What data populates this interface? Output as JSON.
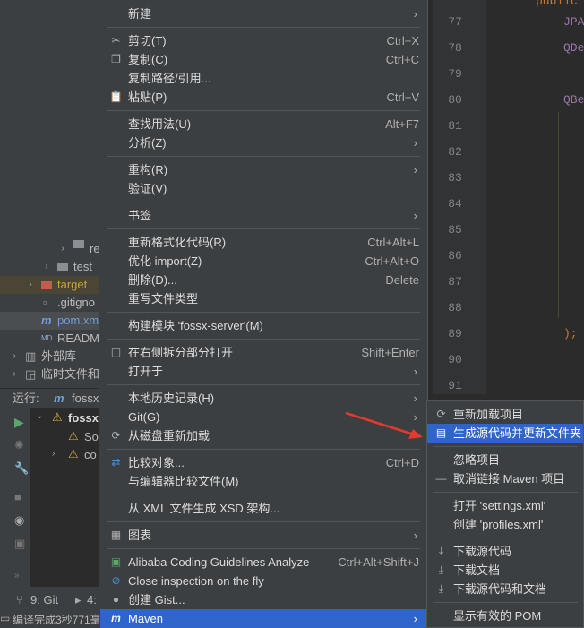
{
  "project_tree": [
    {
      "label": "re",
      "type": "folder",
      "indent": 68
    },
    {
      "label": "test",
      "type": "folder",
      "indent": 50
    },
    {
      "label": "target",
      "type": "folder",
      "indent": 32
    },
    {
      "label": ".gitigno",
      "type": "file"
    },
    {
      "label": "pom.xm",
      "type": "maven"
    },
    {
      "label": "READM",
      "type": "md"
    },
    {
      "label": "外部库",
      "type": "lib"
    },
    {
      "label": "临时文件和控",
      "type": "scratch"
    }
  ],
  "run_bar": {
    "label": "运行:",
    "tab": "fossx"
  },
  "run_tree": {
    "root": "fossx",
    "child1": "So",
    "child2": "co"
  },
  "status_bar": {
    "git_tab": "9: Git",
    "tab2": "4:",
    "message": "编译完成3秒771毫"
  },
  "editor": {
    "line_numbers": [
      "77",
      "78",
      "79",
      "80",
      "81",
      "82",
      "83",
      "84",
      "85",
      "86",
      "87",
      "88",
      "89",
      "90",
      "91"
    ],
    "code": [
      {
        "line": "77",
        "text": "JPA"
      },
      {
        "line": "78",
        "text": "QDe"
      },
      {
        "line": "80",
        "text": "QBe"
      },
      {
        "line": "89",
        "text": ");"
      }
    ],
    "top_text": "public"
  },
  "context_menu": {
    "items": [
      {
        "label": "新建",
        "shortcut": "",
        "submenu": true,
        "icon": ""
      },
      {
        "sep": true
      },
      {
        "label": "剪切(T)",
        "shortcut": "Ctrl+X",
        "icon": "✂"
      },
      {
        "label": "复制(C)",
        "shortcut": "Ctrl+C",
        "icon": "❐"
      },
      {
        "label": "复制路径/引用...",
        "shortcut": "",
        "icon": ""
      },
      {
        "label": "粘贴(P)",
        "shortcut": "Ctrl+V",
        "icon": "📋"
      },
      {
        "sep": true
      },
      {
        "label": "查找用法(U)",
        "shortcut": "Alt+F7",
        "icon": ""
      },
      {
        "label": "分析(Z)",
        "shortcut": "",
        "submenu": true,
        "icon": ""
      },
      {
        "sep": true
      },
      {
        "label": "重构(R)",
        "shortcut": "",
        "submenu": true,
        "icon": ""
      },
      {
        "label": "验证(V)",
        "shortcut": "",
        "icon": ""
      },
      {
        "sep": true
      },
      {
        "label": "书签",
        "shortcut": "",
        "submenu": true,
        "icon": ""
      },
      {
        "sep": true
      },
      {
        "label": "重新格式化代码(R)",
        "shortcut": "Ctrl+Alt+L",
        "icon": ""
      },
      {
        "label": "优化 import(Z)",
        "shortcut": "Ctrl+Alt+O",
        "icon": ""
      },
      {
        "label": "删除(D)...",
        "shortcut": "Delete",
        "icon": ""
      },
      {
        "label": "重写文件类型",
        "shortcut": "",
        "icon": ""
      },
      {
        "sep": true
      },
      {
        "label": "构建模块 'fossx-server'(M)",
        "shortcut": "",
        "icon": ""
      },
      {
        "sep": true
      },
      {
        "label": "在右侧拆分部分打开",
        "shortcut": "Shift+Enter",
        "icon": "◫"
      },
      {
        "label": "打开于",
        "shortcut": "",
        "submenu": true,
        "icon": ""
      },
      {
        "sep": true
      },
      {
        "label": "本地历史记录(H)",
        "shortcut": "",
        "submenu": true,
        "icon": ""
      },
      {
        "label": "Git(G)",
        "shortcut": "",
        "submenu": true,
        "icon": ""
      },
      {
        "label": "从磁盘重新加载",
        "shortcut": "",
        "icon": "⟳"
      },
      {
        "sep": true
      },
      {
        "label": "比较对象...",
        "shortcut": "Ctrl+D",
        "icon": "⇄"
      },
      {
        "label": "与编辑器比较文件(M)",
        "shortcut": "",
        "icon": ""
      },
      {
        "sep": true
      },
      {
        "label": "从 XML 文件生成 XSD 架构...",
        "shortcut": "",
        "icon": ""
      },
      {
        "sep": true
      },
      {
        "label": "图表",
        "shortcut": "",
        "submenu": true,
        "icon": "▦"
      },
      {
        "sep": true
      },
      {
        "label": "Alibaba Coding Guidelines Analyze",
        "shortcut": "Ctrl+Alt+Shift+J",
        "icon": "▣"
      },
      {
        "label": "Close inspection on the fly",
        "shortcut": "",
        "icon": "⊘"
      },
      {
        "label": "创建 Gist...",
        "shortcut": "",
        "icon": "●"
      },
      {
        "label": "Maven",
        "shortcut": "",
        "submenu": true,
        "icon": "m",
        "highlight": true
      }
    ]
  },
  "maven_submenu": {
    "items": [
      {
        "label": "重新加载项目",
        "icon": "⟳"
      },
      {
        "label": "生成源代码并更新文件夹",
        "icon": "▤",
        "highlight": true
      },
      {
        "sep": true
      },
      {
        "label": "忽略项目",
        "icon": ""
      },
      {
        "label": "取消链接 Maven 项目",
        "icon": "—"
      },
      {
        "sep": true
      },
      {
        "label": "打开 'settings.xml'",
        "icon": ""
      },
      {
        "label": "创建 'profiles.xml'",
        "icon": ""
      },
      {
        "sep": true
      },
      {
        "label": "下载源代码",
        "icon": "⤓"
      },
      {
        "label": "下载文档",
        "icon": "⤓"
      },
      {
        "label": "下载源代码和文档",
        "icon": "⤓"
      },
      {
        "sep": true
      },
      {
        "label": "显示有效的 POM",
        "icon": ""
      }
    ]
  },
  "colors": {
    "highlight": "#2f65ca",
    "arrow": "#e23b2e",
    "bg": "#3c3f41"
  }
}
